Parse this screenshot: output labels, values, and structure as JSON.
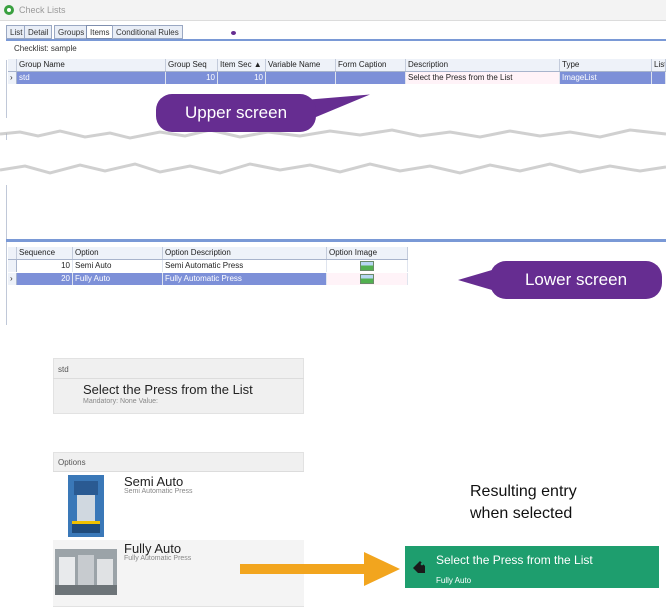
{
  "window": {
    "title": "Check Lists",
    "icon": "app-eye-icon"
  },
  "tabs": [
    {
      "label": "List"
    },
    {
      "label": "Detail"
    },
    {
      "label": "Groups"
    },
    {
      "label": "Items"
    },
    {
      "label": "Conditional Rules"
    }
  ],
  "active_tab": "Items",
  "checklist_label": "Checklist: sample",
  "upper_grid": {
    "columns": [
      "Group Name",
      "Group Seq",
      "Item Sec ▲",
      "Variable Name",
      "Form Caption",
      "Description",
      "Type",
      "List V"
    ],
    "rows": [
      {
        "group_name": "std",
        "group_seq": "10",
        "item_sec": "10",
        "variable_name": "",
        "form_caption": "",
        "description": "Select the Press from the List",
        "type": "ImageList",
        "list_v": ""
      }
    ]
  },
  "lower_grid": {
    "columns": [
      "Sequence",
      "Option",
      "Option Description",
      "Option Image"
    ],
    "rows": [
      {
        "sequence": "10",
        "option": "Semi Auto",
        "description": "Semi Automatic Press"
      },
      {
        "sequence": "20",
        "option": "Fully Auto",
        "description": "Fully Automatic Press"
      }
    ]
  },
  "callouts": {
    "upper": "Upper screen",
    "lower": "Lower screen"
  },
  "preview": {
    "group_header": "std",
    "question": "Select the Press from the List",
    "mandatory_line": "Mandatory: None Value:",
    "options_header": "Options",
    "options": [
      {
        "title": "Semi Auto",
        "subtitle": "Semi Automatic Press"
      },
      {
        "title": "Fully Auto",
        "subtitle": "Fully Automatic Press"
      }
    ]
  },
  "result": {
    "caption_line1": "Resulting entry",
    "caption_line2": "when selected",
    "title": "Select the Press from the List",
    "value": "Fully Auto"
  },
  "colors": {
    "callout": "#662d91",
    "result_card": "#1e9e6e",
    "arrow": "#f2a51e",
    "selected_row": "#7d90d8",
    "tab_line": "#7a99d6"
  }
}
